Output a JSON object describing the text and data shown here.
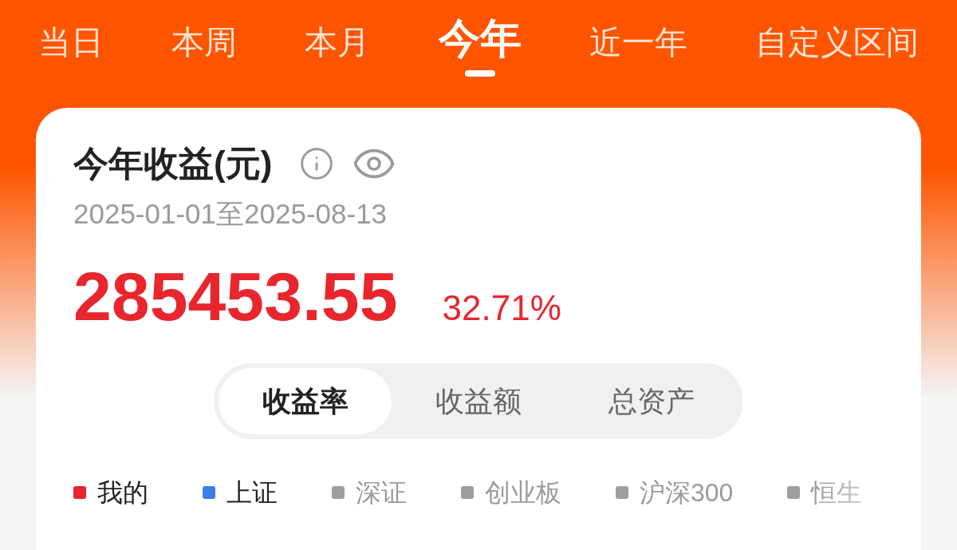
{
  "tabs": [
    {
      "label": "当日",
      "selected": false
    },
    {
      "label": "本周",
      "selected": false
    },
    {
      "label": "本月",
      "selected": false
    },
    {
      "label": "今年",
      "selected": true
    },
    {
      "label": "近一年",
      "selected": false
    },
    {
      "label": "自定义区间",
      "selected": false
    }
  ],
  "card": {
    "title": "今年收益(元)",
    "date_range": "2025-01-01至2025-08-13",
    "amount": "285453.55",
    "return_rate": "32.71%",
    "segments": [
      {
        "label": "收益率",
        "selected": true
      },
      {
        "label": "收益额",
        "selected": false
      },
      {
        "label": "总资产",
        "selected": false
      }
    ],
    "legend": [
      {
        "label": "我的",
        "color": "#e8262d",
        "on": true
      },
      {
        "label": "上证",
        "color": "#3a7ee8",
        "on": true
      },
      {
        "label": "深证",
        "color": "#9e9e9e",
        "on": false
      },
      {
        "label": "创业板",
        "color": "#9e9e9e",
        "on": false
      },
      {
        "label": "沪深300",
        "color": "#9e9e9e",
        "on": false
      },
      {
        "label": "恒生",
        "color": "#9e9e9e",
        "on": false
      }
    ]
  }
}
